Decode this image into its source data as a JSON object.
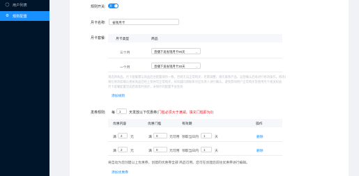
{
  "sidebar": {
    "items": [
      {
        "label": "用户列表",
        "icon": "user-icon"
      },
      {
        "label": "规则配置",
        "icon": "settings-icon",
        "active": true
      }
    ]
  },
  "form": {
    "switch_label": "规则开关:",
    "switch_text": "开",
    "switch_on": true,
    "name_label": "月卡名称:",
    "name_value": "省钱月卡",
    "price_label": "月卡套餐:",
    "price_table": {
      "headers": [
        "月卡类型",
        "商品"
      ],
      "rows": [
        {
          "type": "三个月",
          "product": "直播下发省钱月卡90天"
        },
        {
          "type": "一个月",
          "product": "直播下发省钱月卡30天"
        }
      ]
    },
    "price_note_line1": "请选择商品。月卡套餐需与商品后台配置保持一致，否则无法正常购买，若需调整，请先联系产品、运营确认后再进行修改操作，修改后可能需要一定时间生效，请耐心等待",
    "price_note_line2": "请在修改前确认相关商品已经上架并可正常购买，如有疑问请联系对应负责人进行确认，避免影响用户正常购买及使用月卡相关权益",
    "price_note_line3": "月卡套餐配置完成后请及时保存，未保存的配置不会生效",
    "add_rule_link": "添加规则",
    "coupon_label": "发券规则:",
    "coupon_every": "每",
    "coupon_days": "1",
    "coupon_after": "天发放以下优惠券",
    "coupon_warn": "(门槛必须大于满减，填充门槛即为0)",
    "coupon_table": {
      "headers": [
        "优惠内容",
        "优惠门槛",
        "有效期",
        "操作"
      ],
      "rows": [
        {
          "prefix": "满",
          "amount": "2",
          "unit": "元",
          "threshold_prefix": "满",
          "threshold": "0",
          "threshold_unit": "元可用",
          "valid_prefix": "领取当日内",
          "valid": "1",
          "valid_unit": "天",
          "action": "删除"
        },
        {
          "prefix": "满",
          "amount": "2",
          "unit": "元",
          "threshold_prefix": "满",
          "threshold": "0",
          "threshold_unit": "元可用",
          "valid_prefix": "领取当日内",
          "valid": "1",
          "valid_unit": "天",
          "action": "删除"
        }
      ]
    },
    "coupon_note": "将自动为您创建以上优惠券，创建的优惠券全部 商品可用。您可在创建后前往优惠券进行编辑。",
    "add_coupon_link": "添加优惠券"
  }
}
